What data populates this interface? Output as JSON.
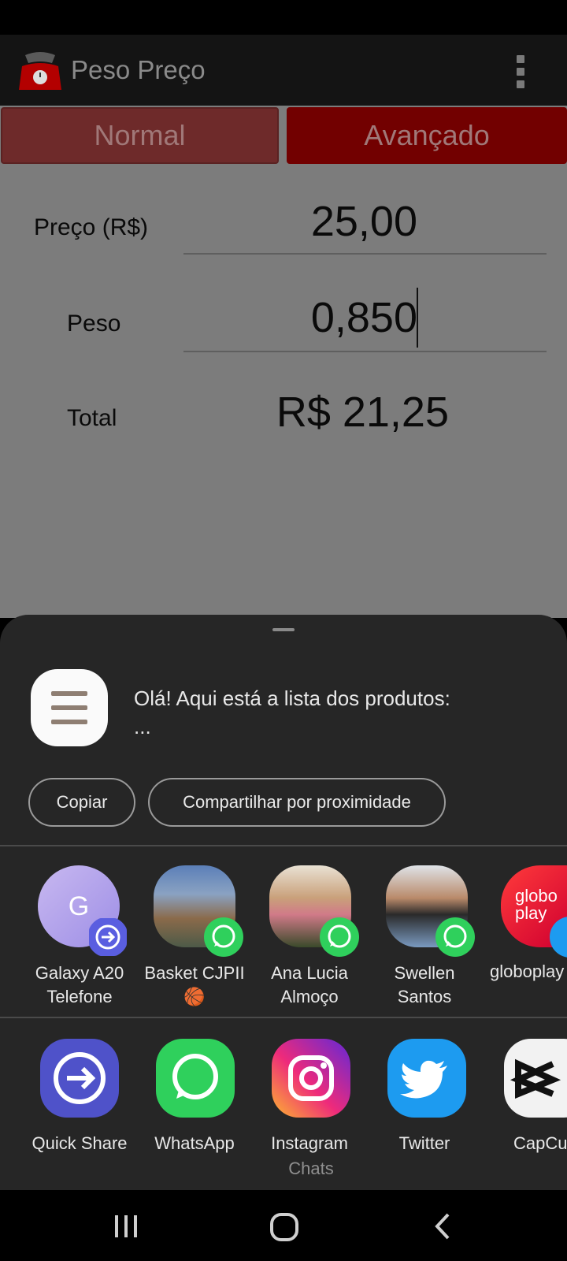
{
  "app": {
    "title": "Peso Preço"
  },
  "tabs": [
    {
      "label": "Normal"
    },
    {
      "label": "Avançado"
    }
  ],
  "form": {
    "price_label": "Preço (R$)",
    "price_value": "25,00",
    "weight_label": "Peso",
    "weight_value": "0,850",
    "total_label": "Total",
    "total_value": "R$ 21,25"
  },
  "share": {
    "preview_line1": "Olá! Aqui está a lista dos produtos:",
    "preview_line2": "...",
    "copy_label": "Copiar",
    "nearby_label": "Compartilhar por proximidade",
    "contacts": [
      {
        "line1": "Galaxy A20",
        "line2": "Telefone",
        "avatar_letter": "G",
        "badge": "quick-share"
      },
      {
        "line1": "Basket CJPII",
        "line2": "🏀",
        "badge": "whatsapp"
      },
      {
        "line1": "Ana Lucia",
        "line2": "Almoço",
        "badge": "whatsapp"
      },
      {
        "line1": "Swellen",
        "line2": "Santos",
        "badge": "whatsapp"
      },
      {
        "line1": "globoplay",
        "line2": "",
        "avatar_line1": "globo",
        "avatar_line2": "play",
        "badge": "twitter"
      }
    ],
    "apps": [
      {
        "label": "Quick Share",
        "icon": "quick-share-icon"
      },
      {
        "label": "WhatsApp",
        "icon": "whatsapp-icon"
      },
      {
        "label": "Instagram",
        "sublabel": "Chats",
        "icon": "instagram-icon"
      },
      {
        "label": "Twitter",
        "icon": "twitter-icon"
      },
      {
        "label": "CapCut",
        "icon": "capcut-icon"
      }
    ]
  },
  "colors": {
    "accent_red": "#720000",
    "whatsapp_green": "#2fd05c",
    "twitter_blue": "#1d9bf0",
    "quick_share_purple": "#5a5ee0",
    "sheet_bg": "#262626"
  }
}
